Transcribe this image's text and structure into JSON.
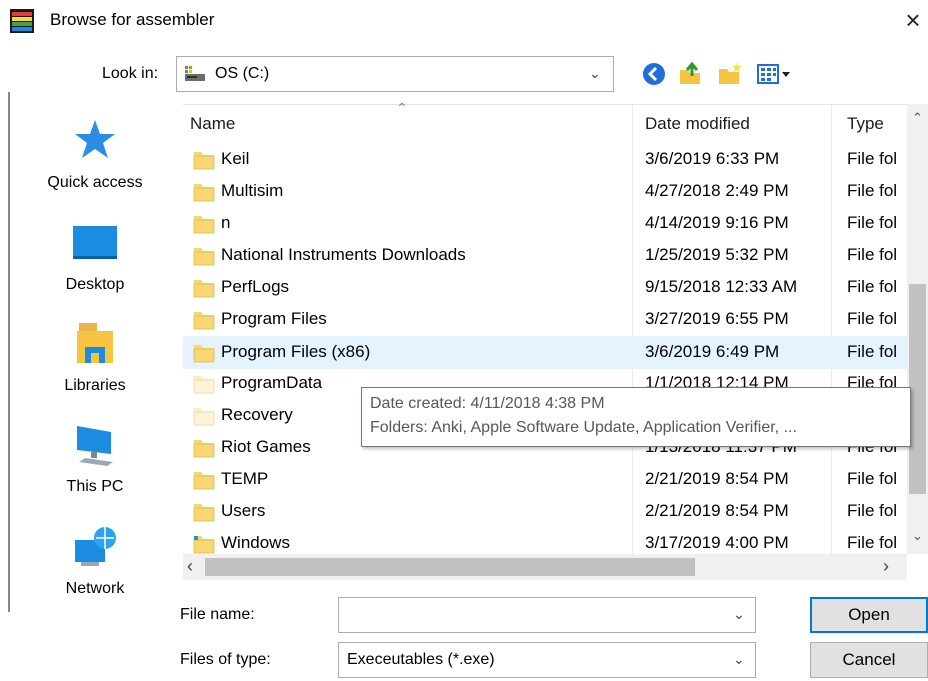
{
  "window": {
    "title": "Browse for assembler",
    "close_symbol": "×"
  },
  "look_in": {
    "label": "Look in:",
    "value": "OS (C:)"
  },
  "toolbar": {
    "icons": [
      "back-icon",
      "up-folder-icon",
      "new-folder-icon",
      "view-menu-icon"
    ]
  },
  "nav": {
    "items": [
      {
        "label": "Quick access",
        "icon": "star-icon"
      },
      {
        "label": "Desktop",
        "icon": "desktop-icon"
      },
      {
        "label": "Libraries",
        "icon": "libraries-icon"
      },
      {
        "label": "This PC",
        "icon": "computer-icon"
      },
      {
        "label": "Network",
        "icon": "network-icon"
      }
    ]
  },
  "columns": {
    "name": "Name",
    "date": "Date modified",
    "type": "Type"
  },
  "files": [
    {
      "name": "Keil",
      "date": "3/6/2019 6:33 PM",
      "type": "File fol",
      "icon": "folder"
    },
    {
      "name": "Multisim",
      "date": "4/27/2018 2:49 PM",
      "type": "File fol",
      "icon": "folder"
    },
    {
      "name": "n",
      "date": "4/14/2019 9:16 PM",
      "type": "File fol",
      "icon": "folder"
    },
    {
      "name": "National Instruments Downloads",
      "date": "1/25/2019 5:32 PM",
      "type": "File fol",
      "icon": "folder"
    },
    {
      "name": "PerfLogs",
      "date": "9/15/2018 12:33 AM",
      "type": "File fol",
      "icon": "folder"
    },
    {
      "name": "Program Files",
      "date": "3/27/2019 6:55 PM",
      "type": "File fol",
      "icon": "folder"
    },
    {
      "name": "Program Files (x86)",
      "date": "3/6/2019 6:49 PM",
      "type": "File fol",
      "icon": "folder"
    },
    {
      "name": "ProgramData",
      "date": "1/1/2018 12:14 PM",
      "type": "File fol",
      "icon": "hidden-folder"
    },
    {
      "name": "Recovery",
      "date": "",
      "type": "",
      "icon": "hidden-folder"
    },
    {
      "name": "Riot Games",
      "date": "1/13/2018 11:37 PM",
      "type": "File fol",
      "icon": "folder"
    },
    {
      "name": "TEMP",
      "date": "2/21/2019 8:54 PM",
      "type": "File fol",
      "icon": "folder"
    },
    {
      "name": "Users",
      "date": "2/21/2019 8:54 PM",
      "type": "File fol",
      "icon": "folder"
    },
    {
      "name": "Windows",
      "date": "3/17/2019 4:00 PM",
      "type": "File fol",
      "icon": "system-folder"
    }
  ],
  "tooltip": {
    "line1": "Date created: 4/11/2018 4:38 PM",
    "line2": "Folders: Anki, Apple Software Update, Application Verifier, ..."
  },
  "file_name": {
    "label": "File name:",
    "value": ""
  },
  "file_type": {
    "label": "Files of type:",
    "value": "Execeutables (*.exe)"
  },
  "buttons": {
    "open": "Open",
    "cancel": "Cancel"
  },
  "colors": {
    "accent": "#0078d7",
    "selection": "#e5f3ff",
    "folder": "#f8d775"
  }
}
